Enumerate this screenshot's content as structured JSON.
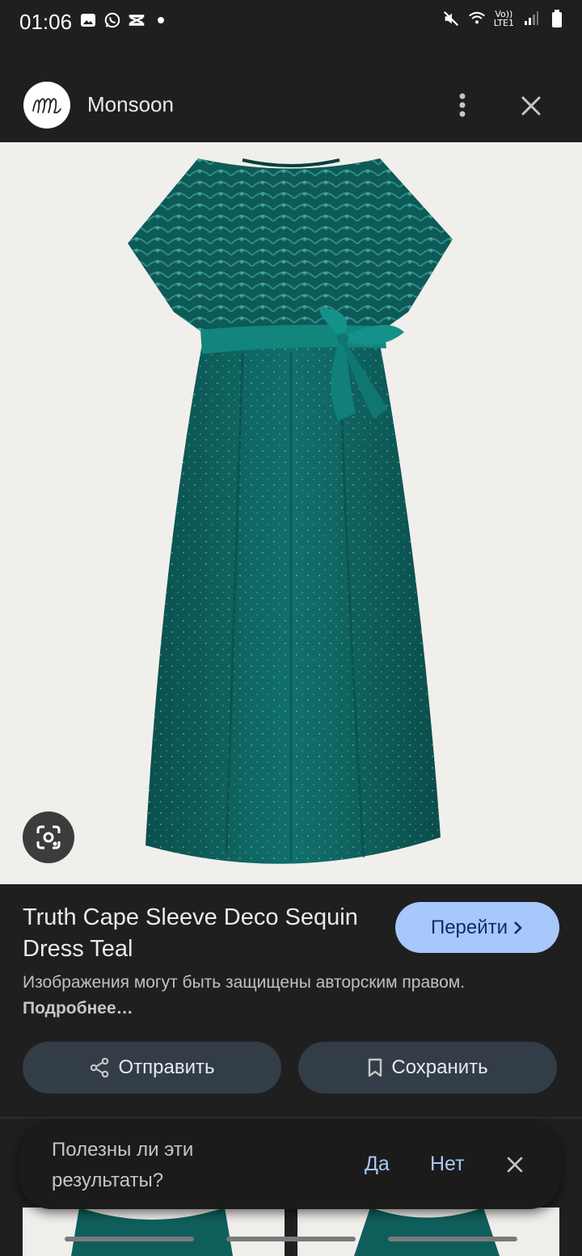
{
  "status_bar": {
    "time": "01:06",
    "network": "LTE1",
    "volte": "Vo))"
  },
  "header": {
    "site_name": "Monsoon"
  },
  "result": {
    "title": "Truth Cape Sleeve Deco Sequin Dress Teal",
    "visit_label": "Перейти",
    "copyright_notice": "Изображения могут быть защищены авторским правом.",
    "more_link": "Подробнее…"
  },
  "actions": {
    "share_label": "Отправить",
    "save_label": "Сохранить"
  },
  "feedback": {
    "question": "Полезны ли эти результаты?",
    "yes_label": "Да",
    "no_label": "Нет"
  },
  "colors": {
    "dress_teal": "#0e5f5c",
    "accent_blue": "#a8c7fa",
    "background": "#1f1f1f"
  },
  "icons": [
    "gallery-icon",
    "whatsapp-icon",
    "capcut-icon",
    "mute-icon",
    "wifi-icon",
    "signal-icon",
    "battery-icon",
    "more-vert-icon",
    "close-icon",
    "lens-icon",
    "chevron-right-icon",
    "share-icon",
    "bookmark-icon"
  ]
}
